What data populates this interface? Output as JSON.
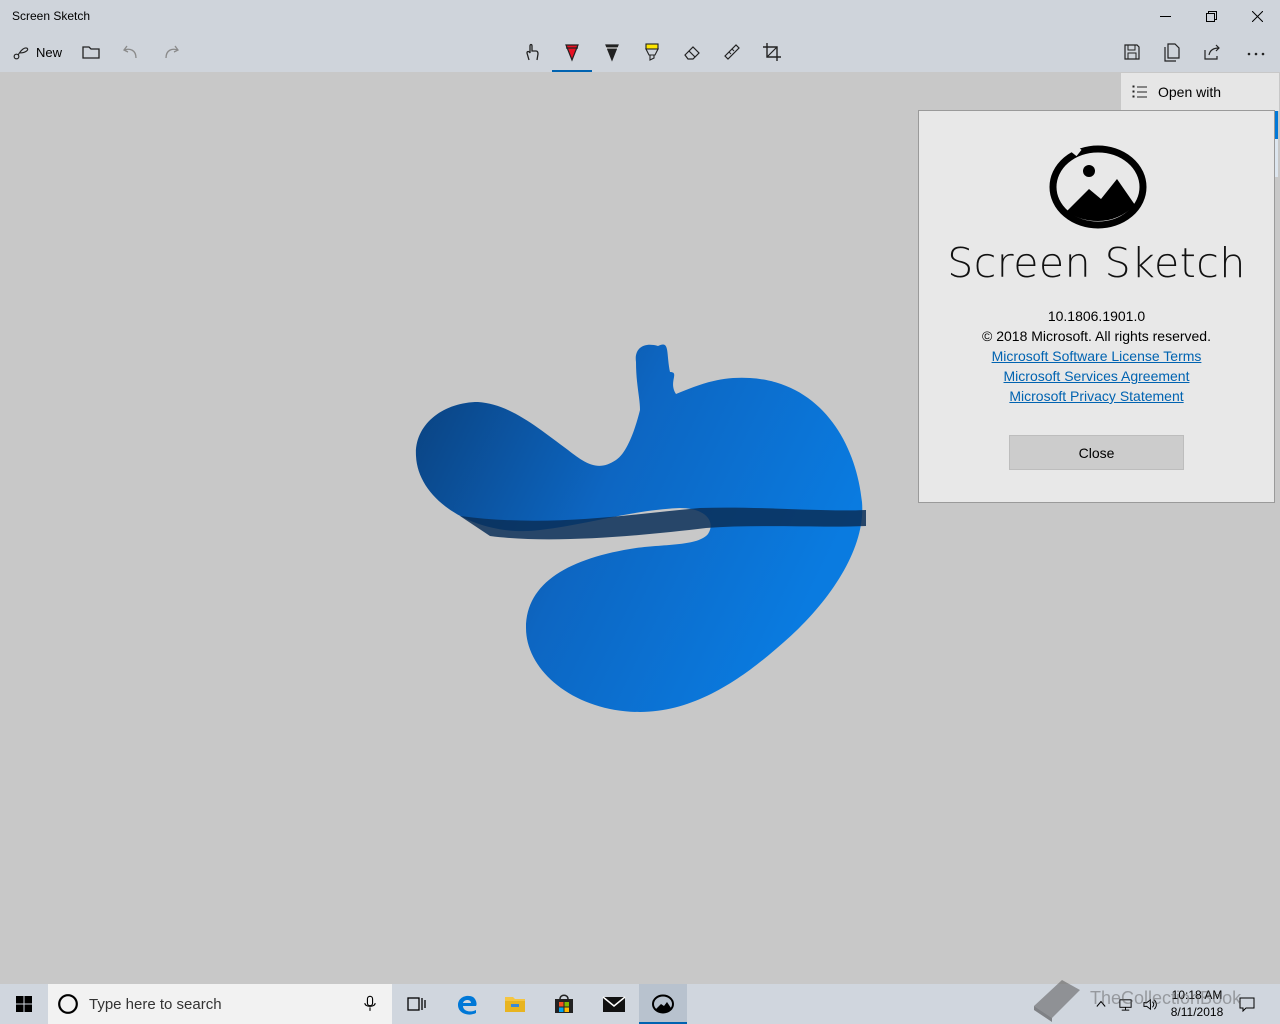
{
  "window": {
    "title": "Screen Sketch"
  },
  "toolbar": {
    "new_label": "New",
    "tools": [
      "touch-writing",
      "ballpoint-pen",
      "pencil",
      "highlighter",
      "eraser",
      "ruler",
      "crop"
    ],
    "active_tool": "ballpoint-pen"
  },
  "flyout": {
    "open_with_label": "Open with"
  },
  "about": {
    "app_name": "Screen Sketch",
    "version": "10.1806.1901.0",
    "copyright": "© 2018 Microsoft. All rights reserved.",
    "links": [
      "Microsoft Software License Terms",
      "Microsoft Services Agreement",
      "Microsoft Privacy Statement"
    ],
    "close_label": "Close"
  },
  "taskbar": {
    "search_placeholder": "Type here to search",
    "time": "10:18 AM",
    "date": "8/11/2018"
  },
  "watermark": "TheCollectionBook",
  "colors": {
    "accent": "#0063b1",
    "link": "#0063b1",
    "canvas": "#c8c8c8",
    "chrome": "#cfd4db",
    "shape_blue": "#0a6fd0"
  }
}
